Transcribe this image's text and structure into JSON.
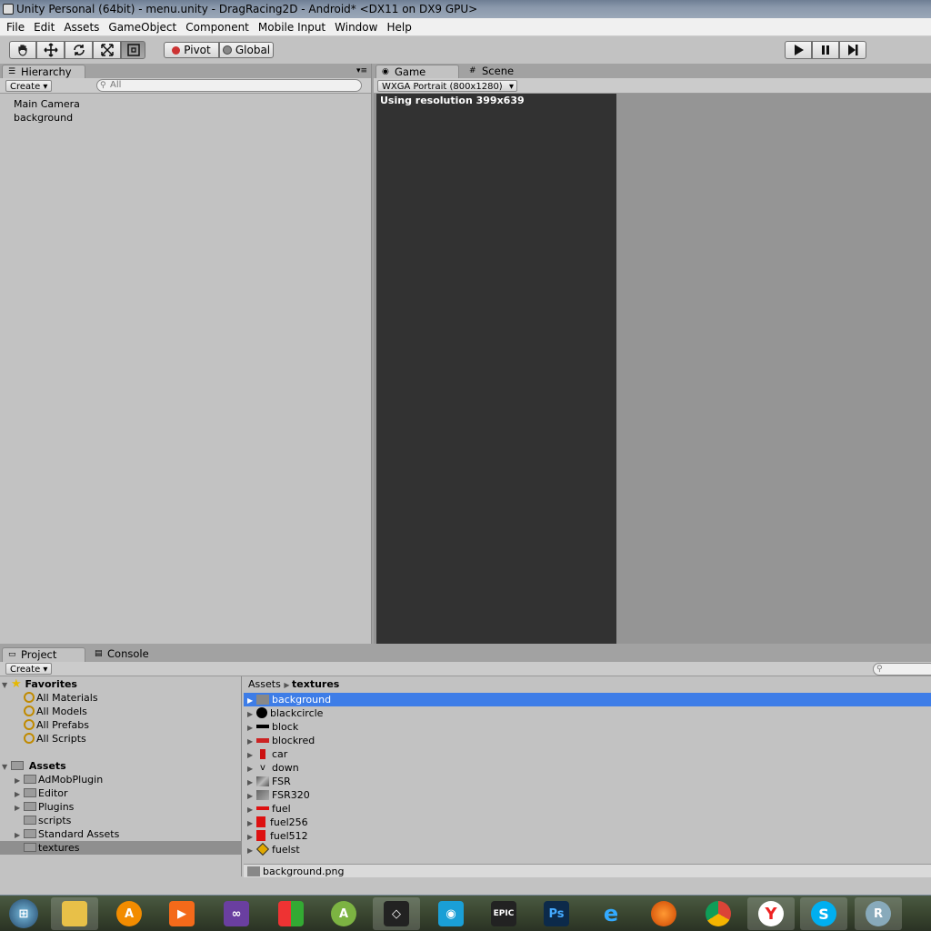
{
  "window": {
    "title": "Unity Personal (64bit) - menu.unity - DragRacing2D - Android* <DX11 on DX9 GPU>"
  },
  "menu": [
    "File",
    "Edit",
    "Assets",
    "GameObject",
    "Component",
    "Mobile Input",
    "Window",
    "Help"
  ],
  "toolbar": {
    "pivot": "Pivot",
    "global": "Global"
  },
  "hierarchy": {
    "tab": "Hierarchy",
    "create": "Create",
    "search_placeholder": "All",
    "items": [
      "Main Camera",
      "background"
    ]
  },
  "game": {
    "tab": "Game",
    "scene_tab": "Scene",
    "resolution_select": "WXGA Portrait (800x1280)",
    "resolution_text": "Using resolution 399x639"
  },
  "project": {
    "tab": "Project",
    "console_tab": "Console",
    "create": "Create",
    "favorites_label": "Favorites",
    "favorites": [
      "All Materials",
      "All Models",
      "All Prefabs",
      "All Scripts"
    ],
    "assets_label": "Assets",
    "folders": [
      "AdMobPlugin",
      "Editor",
      "Plugins",
      "scripts",
      "Standard Assets",
      "textures"
    ],
    "breadcrumb_root": "Assets",
    "breadcrumb_current": "textures",
    "files": [
      "background",
      "blackcircle",
      "block",
      "blockred",
      "car",
      "down",
      "FSR",
      "FSR320",
      "fuel",
      "fuel256",
      "fuel512",
      "fuelst"
    ],
    "selected_file_path": "background.png"
  },
  "taskbar": [
    "start",
    "explorer",
    "avast",
    "media-player",
    "visual-studio",
    "windows-store",
    "android-studio",
    "unity",
    "network",
    "epic-games",
    "photoshop",
    "internet-explorer",
    "firefox",
    "chrome",
    "yandex",
    "skype",
    "remote-desktop"
  ],
  "colors": {
    "selection": "#3e7de7",
    "game_view": "#323232",
    "panel": "#c2c2c2"
  }
}
